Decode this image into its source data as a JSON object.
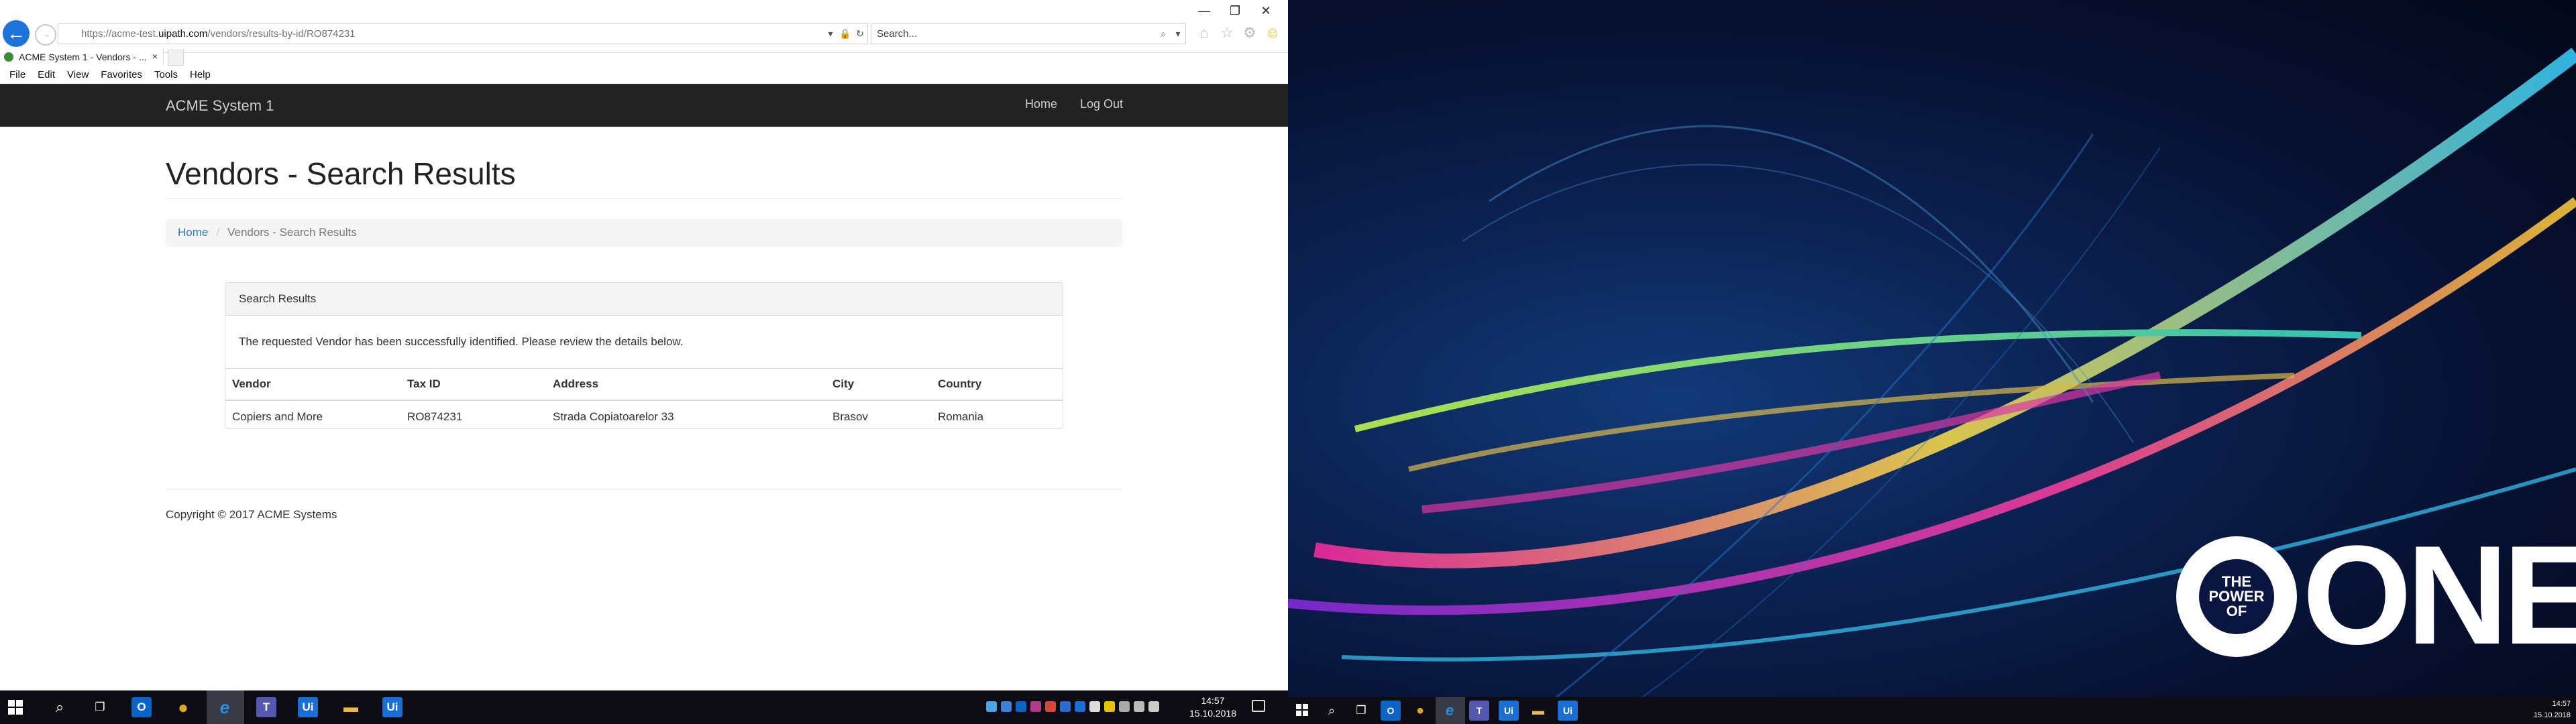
{
  "browser": {
    "url_prefix": "https://acme-test.",
    "url_domain": "uipath.com",
    "url_path": "/vendors/results-by-id/RO874231",
    "search_placeholder": "Search...",
    "tab_title": "ACME System 1 - Vendors - ...",
    "tab_close": "×",
    "menu": [
      "File",
      "Edit",
      "View",
      "Favorites",
      "Tools",
      "Help"
    ],
    "window_controls": [
      "—",
      "❐",
      "✕"
    ]
  },
  "app": {
    "brand": "ACME System 1",
    "nav": [
      "Home",
      "Log Out"
    ],
    "page_title": "Vendors - Search Results",
    "breadcrumb": {
      "home": "Home",
      "separator": "/",
      "current": "Vendors - Search Results"
    },
    "panel": {
      "heading": "Search Results",
      "message": "The requested Vendor has been successfully identified. Please review the details below.",
      "columns": [
        "Vendor",
        "Tax ID",
        "Address",
        "City",
        "Country"
      ],
      "rows": [
        [
          "Copiers and More",
          "RO874231",
          "Strada Copiatoarelor 33",
          "Brasov",
          "Romania"
        ]
      ]
    },
    "footer": "Copyright © 2017 ACME Systems"
  },
  "taskbar": {
    "time": "14:57",
    "date": "15.10.2018",
    "apps": [
      {
        "name": "search-icon",
        "glyph": "⌕"
      },
      {
        "name": "task-view-icon",
        "glyph": "❐"
      },
      {
        "name": "outlook-icon",
        "glyph": "O",
        "color": "#0a64c8"
      },
      {
        "name": "chrome-icon",
        "glyph": "●",
        "color": "#e0a820"
      },
      {
        "name": "ie-icon",
        "glyph": "e",
        "color": "#2b8fe0"
      },
      {
        "name": "teams-icon",
        "glyph": "T",
        "color": "#5558af"
      },
      {
        "name": "uipath-studio-icon",
        "glyph": "Ui",
        "color": "#1a6fd4"
      },
      {
        "name": "file-explorer-icon",
        "glyph": "▬",
        "color": "#e8b94a"
      },
      {
        "name": "uipath-robot-icon",
        "glyph": "Ui",
        "color": "#1a6fd4"
      }
    ]
  },
  "wallpaper": {
    "circle_text": [
      "THE",
      "POWER",
      "OF"
    ],
    "word": "ONE"
  },
  "colors": {
    "navbar": "#222222",
    "link": "#337ab7",
    "ie_accent": "#1e73d8"
  }
}
